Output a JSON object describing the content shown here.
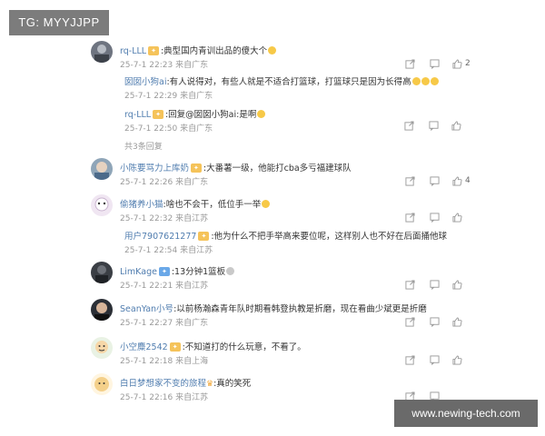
{
  "overlay": {
    "tag": "TG: MYYJJPP",
    "watermark": "www.newing-tech.com"
  },
  "comments": [
    {
      "user": "rq-LLL",
      "text": "典型国内青训出品的傻大个",
      "time": "25-7-1 22:23",
      "location": "来自广东",
      "likes": "2"
    },
    {
      "user": "囡囡小狗ai",
      "text": "有人说得对，有些人就是不适合打篮球，打篮球只是因为长得高",
      "time": "25-7-1 22:29",
      "location": "来自广东",
      "likes": ""
    },
    {
      "user": "rq-LLL",
      "text": "回复@囡囡小狗ai:是啊",
      "time": "25-7-1 22:50",
      "location": "来自广东",
      "likes": ""
    },
    {
      "user": "小陈要骂力上库奶",
      "text": "大番薯一级，他能打cba多亏福建球队",
      "time": "25-7-1 22:26",
      "location": "来自广东",
      "likes": "4"
    },
    {
      "user": "偷猪养小猫",
      "text": "啥也不会干，低位手一举",
      "time": "25-7-1 22:32",
      "location": "来自江苏",
      "likes": ""
    },
    {
      "user": "用户7907621277",
      "text": "他为什么不把手举高来要位呢，这样别人也不好在后面捅他球",
      "time": "25-7-1 22:54",
      "location": "来自江苏",
      "likes": ""
    },
    {
      "user": "LimKage",
      "text": "13分钟1篮板",
      "time": "25-7-1 22:21",
      "location": "来自江苏",
      "likes": ""
    },
    {
      "user": "SeanYan小号",
      "text": "以前杨瀚森青年队时期看韩登执教是折磨，现在看曲少斌更是折磨",
      "time": "25-7-1 22:27",
      "location": "来自广东",
      "likes": ""
    },
    {
      "user": "小空麋2542",
      "text": "不知道打的什么玩意，不看了。",
      "time": "25-7-1 22:18",
      "location": "来自上海",
      "likes": ""
    },
    {
      "user": "白日梦想家不变的旅程",
      "text": "真的笑死",
      "time": "25-7-1 22:16",
      "location": "来自江苏",
      "likes": ""
    }
  ],
  "more_replies": "共3条回复",
  "icons": [
    "share-icon",
    "comment-icon",
    "like-icon"
  ]
}
